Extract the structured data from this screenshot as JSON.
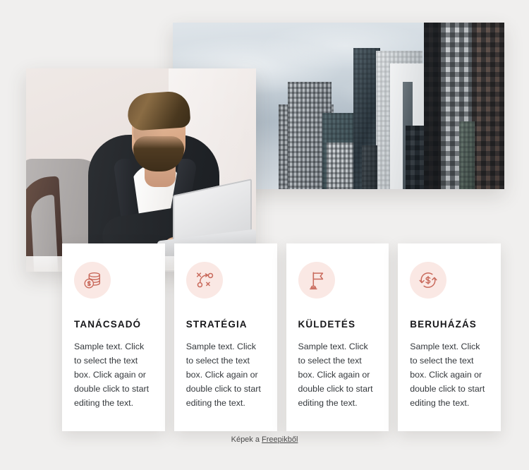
{
  "page": {
    "background_color": "#f0efee",
    "accent_color": "#c96a5c",
    "icon_bg_color": "#fae8e4"
  },
  "hero": {
    "images": [
      {
        "name": "cityscape-photo",
        "alt": "Modern glass office skyscrapers against a cloudy sky"
      },
      {
        "name": "businessman-photo",
        "alt": "Bearded businessman in a dark blazer working on a laptop"
      }
    ]
  },
  "cards": [
    {
      "icon": "coin-stack-dollar-icon",
      "title": "TANÁCSADÓ",
      "text": "Sample text. Click to select the text box. Click again or double click to start editing the text."
    },
    {
      "icon": "strategy-playbook-icon",
      "title": "STRATÉGIA",
      "text": "Sample text. Click to select the text box. Click again or double click to start editing the text."
    },
    {
      "icon": "flag-icon",
      "title": "KÜLDETÉS",
      "text": "Sample text. Click to select the text box. Click again or double click to start editing the text."
    },
    {
      "icon": "currency-exchange-icon",
      "title": "BERUHÁZÁS",
      "text": "Sample text. Click to select the text box. Click again or double click to start editing the text."
    }
  ],
  "footer": {
    "prefix": "Képek a ",
    "link_label": "Freepikből"
  }
}
